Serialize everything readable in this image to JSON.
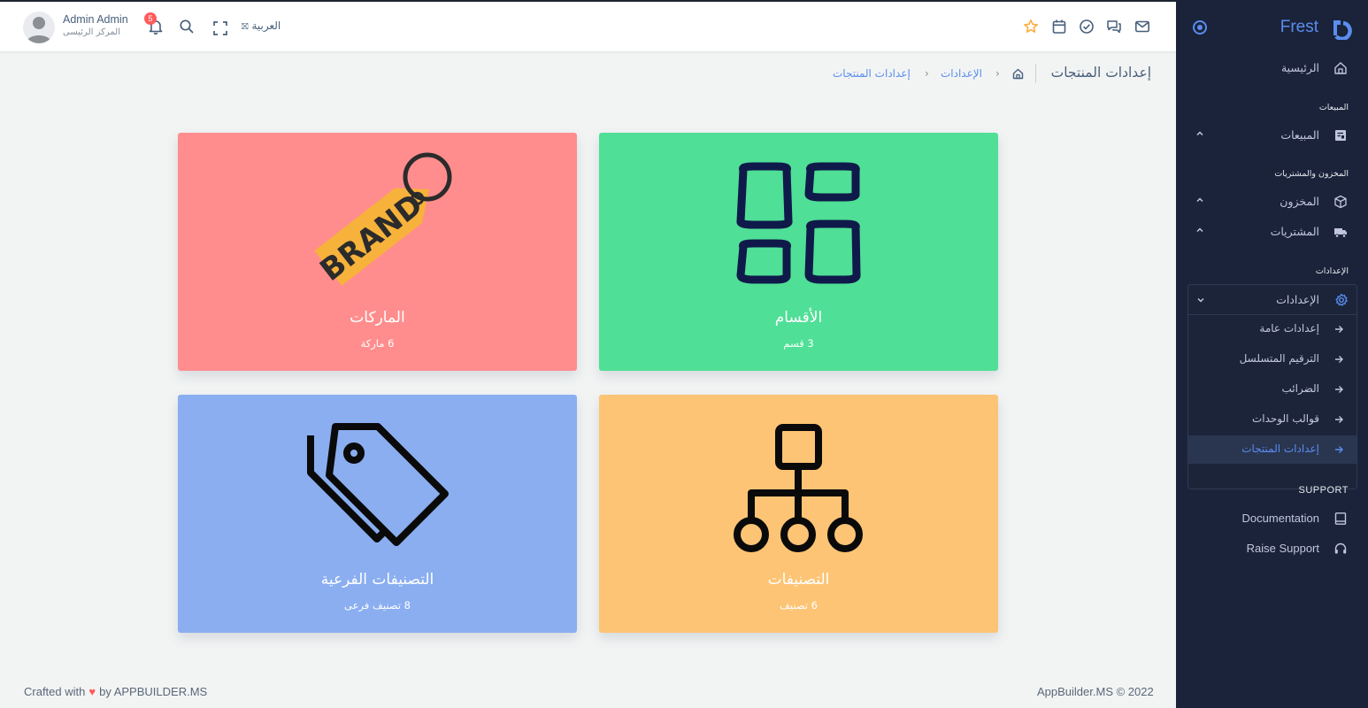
{
  "brand": {
    "name": "Frest"
  },
  "sidebar": {
    "home": "الرئيسية",
    "section_sales": "المبيعات",
    "sales": "المبيعات",
    "section_inventory": "المخزون والمشتريات",
    "inventory": "المخزون",
    "purchases": "المشتريات",
    "section_settings": "الإعدادات",
    "settings": "الإعدادات",
    "settings_items": [
      {
        "label": "إعدادات عامة"
      },
      {
        "label": "الترقيم المتسلسل"
      },
      {
        "label": "الضرائب"
      },
      {
        "label": "قوالب الوحدات"
      },
      {
        "label": "إعدادات المنتجات",
        "active": true
      }
    ],
    "section_support": "SUPPORT",
    "documentation": "Documentation",
    "raise_support": "Raise Support"
  },
  "navbar": {
    "user_name": "Admin Admin",
    "user_role": "المركز الرئيسى",
    "notifications_count": "5",
    "language": "العربية",
    "icons": [
      "mail-icon",
      "chat-icon",
      "check-circle-icon",
      "calendar-icon",
      "star-icon"
    ]
  },
  "breadcrumb": {
    "page_title": "إعدادات المنتجات",
    "settings_link": "الإعدادات",
    "current": "إعدادات المنتجات"
  },
  "cards": [
    {
      "title": "الماركات",
      "count": "6 ماركة",
      "color": "#ff8d8d",
      "icon": "brand-tag-icon"
    },
    {
      "title": "الأقسام",
      "count": "3 قسم",
      "color": "#4fdf96",
      "icon": "grid-icon"
    },
    {
      "title": "التصنيفات الفرعية",
      "count": "8 تصنيف فرعى",
      "color": "#8aaef0",
      "icon": "tags-icon"
    },
    {
      "title": "التصنيفات",
      "count": "6 تصنيف",
      "color": "#fcc474",
      "icon": "hierarchy-icon"
    }
  ],
  "footer": {
    "crafted_prefix": "Crafted with",
    "crafted_suffix": "by APPBUILDER.MS",
    "copyright": "AppBuilder.MS © 2022"
  }
}
